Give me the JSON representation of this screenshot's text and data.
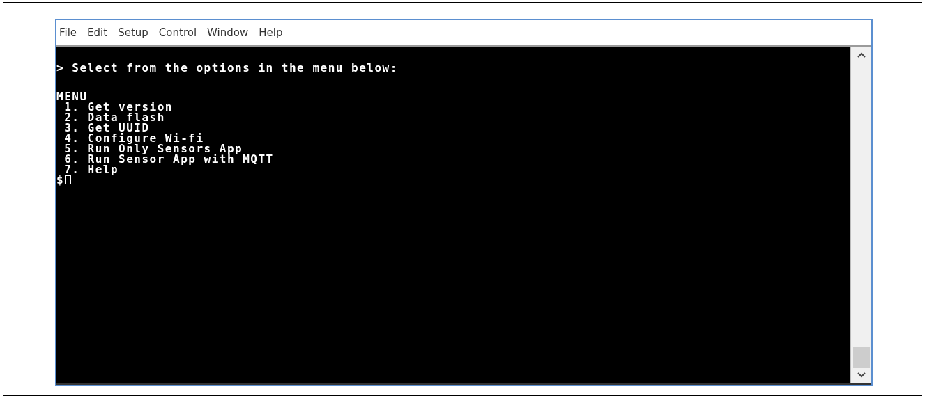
{
  "menu_bar": [
    "File",
    "Edit",
    "Setup",
    "Control",
    "Window",
    "Help"
  ],
  "terminal": {
    "message": "> Select from the options in the menu below:",
    "heading": "MENU",
    "options": [
      " 1. Get version",
      " 2. Data flash",
      " 3. Get UUID",
      " 4. Configure Wi-fi",
      " 5. Run Only Sensors App",
      " 6. Run Sensor App with MQTT",
      " 7. Help"
    ],
    "input_prompt": "$"
  }
}
